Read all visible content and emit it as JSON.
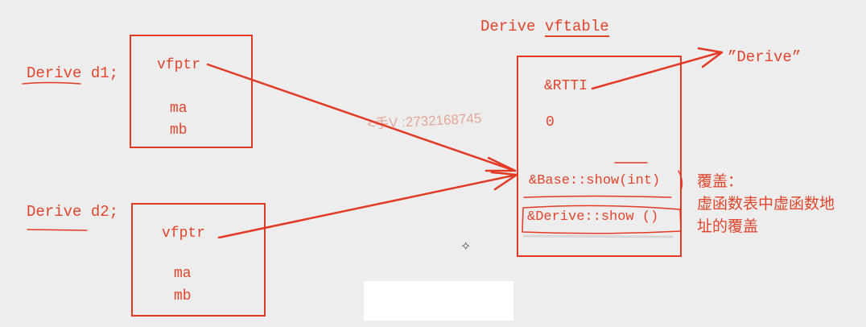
{
  "d1": {
    "label": "Derive d1;",
    "vfptr": "vfptr",
    "ma": "ma",
    "mb": "mb"
  },
  "d2": {
    "label": "Derive d2;",
    "vfptr": "vfptr",
    "ma": "ma",
    "mb": "mb"
  },
  "vftable": {
    "title_prefix": "Derive",
    "title_word": "vftable",
    "rtti": "&RTTI",
    "offset": "0",
    "base_show": "&Base::show(int)",
    "derive_show": "&Derive::show ()"
  },
  "rtti_target": "”Derive”",
  "note": {
    "title": "覆盖：",
    "line1": "虚函数表中虚函数地",
    "line2": "址的覆盖"
  },
  "watermark": "<手V :2732168745",
  "colors": {
    "accent": "#e23a25",
    "text": "#e0452c",
    "background": "#ededed"
  }
}
